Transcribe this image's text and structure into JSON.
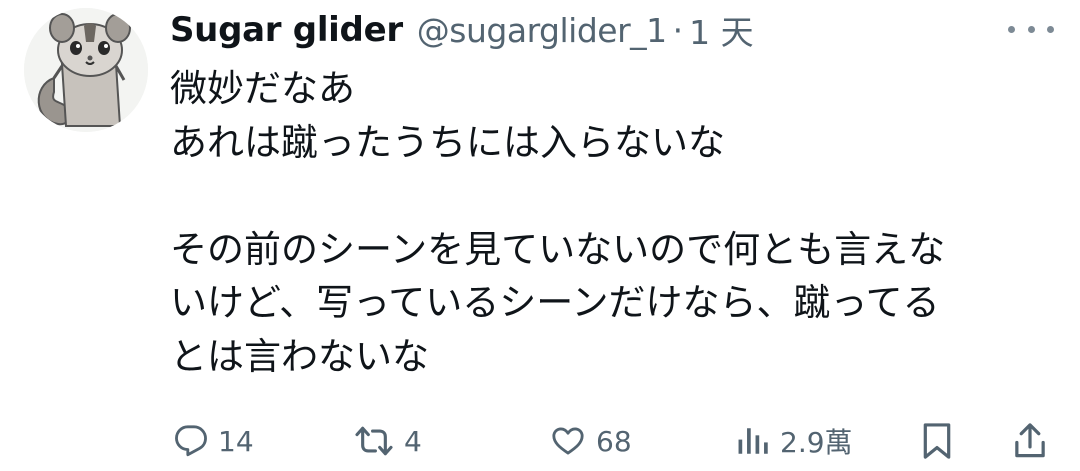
{
  "tweet": {
    "display_name": "Sugar glider",
    "handle": "@sugarglider_1",
    "separator": "·",
    "time": "1 天",
    "text": "微妙だなあ\nあれは蹴ったうちには入らないな\n\nその前のシーンを見ていないので何とも言えな\nいけど、写っているシーンだけなら、蹴ってる\nとは言わないな"
  },
  "actions": {
    "reply_count": "14",
    "retweet_count": "4",
    "like_count": "68",
    "views_count": "2.9萬"
  },
  "icons": {
    "avatar": "sugar-glider-avatar",
    "more": "more-icon",
    "reply": "reply-icon",
    "retweet": "retweet-icon",
    "like": "heart-icon",
    "views": "views-icon",
    "bookmark": "bookmark-icon",
    "share": "share-icon"
  },
  "colors": {
    "text_primary": "#0f1419",
    "text_secondary": "#536471",
    "background": "#ffffff"
  }
}
